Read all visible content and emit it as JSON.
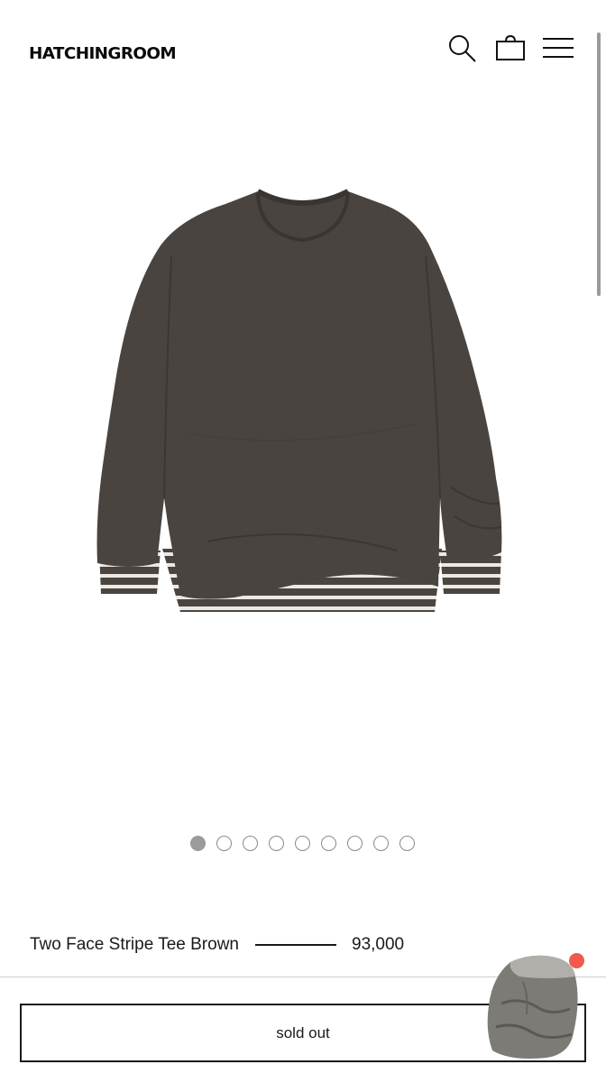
{
  "header": {
    "brand": "HATCHINGROOM",
    "icons": [
      "search-icon",
      "shopping-bag-icon",
      "hamburger-menu-icon"
    ]
  },
  "gallery": {
    "image_alt": "dark brown long sleeve tee with striped layer",
    "total_slides": 9,
    "active_slide": 1
  },
  "product": {
    "name": "Two Face Stripe Tee Brown",
    "price": "93,000"
  },
  "actions": {
    "sold_out_label": "sold out"
  },
  "colors": {
    "garment": "#4a4440",
    "notification": "#f05a4f"
  }
}
